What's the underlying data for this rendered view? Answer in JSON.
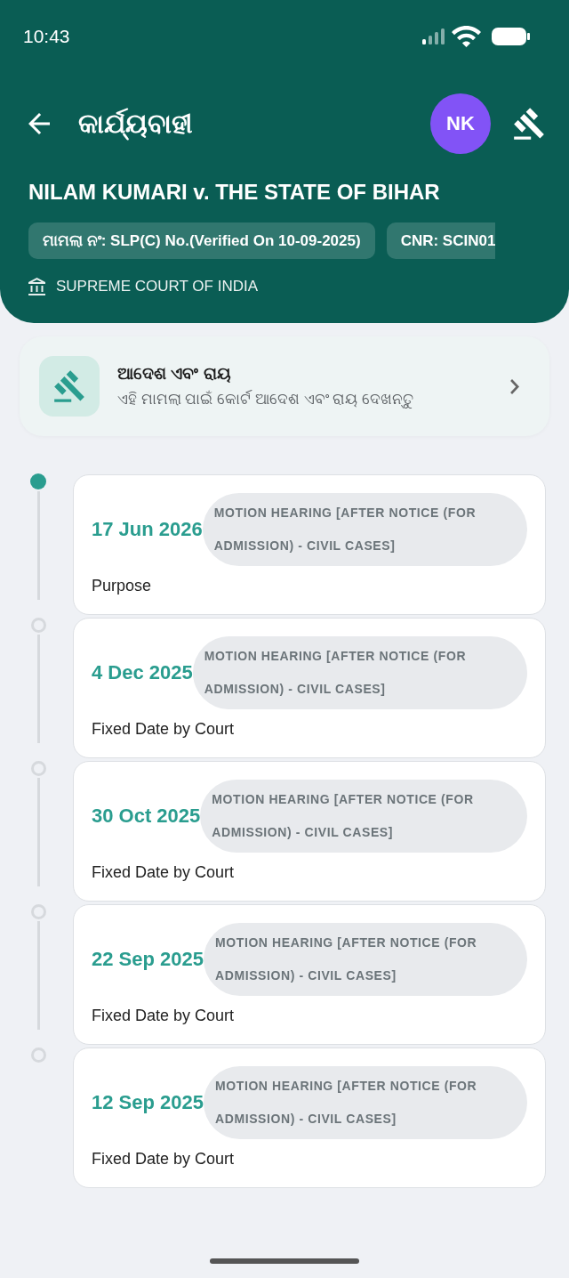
{
  "status_bar": {
    "time": "10:43"
  },
  "app_bar": {
    "title": "କାର୍ଯ୍ୟବାହୀ",
    "avatar": "NK"
  },
  "case": {
    "title": "NILAM KUMARI v. THE STATE OF BIHAR",
    "chips": [
      "ମାମଲା ନଂ: SLP(C) No.(Verified On 10-09-2025)",
      "CNR: SCIN01"
    ],
    "court": "SUPREME COURT OF INDIA"
  },
  "orders_card": {
    "title": "ଆଦେଶ ଏବଂ ରାୟ",
    "subtitle": "ଏହି ମାମଲା ପାଇଁ କୋର୍ଟ ଆଦେଶ ଏବଂ ରାୟ ଦେଖନ୍ତୁ"
  },
  "hearings": [
    {
      "date": "17 Jun 2026",
      "stage": "MOTION HEARING [AFTER NOTICE (FOR ADMISSION) - CIVIL CASES]",
      "purpose": "Purpose",
      "current": true
    },
    {
      "date": "4 Dec 2025",
      "stage": "MOTION HEARING [AFTER NOTICE (FOR ADMISSION) - CIVIL CASES]",
      "purpose": "Fixed Date by Court",
      "current": false
    },
    {
      "date": "30 Oct 2025",
      "stage": "MOTION HEARING [AFTER NOTICE (FOR ADMISSION) - CIVIL CASES]",
      "purpose": "Fixed Date by Court",
      "current": false
    },
    {
      "date": "22 Sep 2025",
      "stage": "MOTION HEARING [AFTER NOTICE (FOR ADMISSION) - CIVIL CASES]",
      "purpose": "Fixed Date by Court",
      "current": false
    },
    {
      "date": "12 Sep 2025",
      "stage": "MOTION HEARING [AFTER NOTICE (FOR ADMISSION) - CIVIL CASES]",
      "purpose": "Fixed Date by Court",
      "current": false
    }
  ]
}
